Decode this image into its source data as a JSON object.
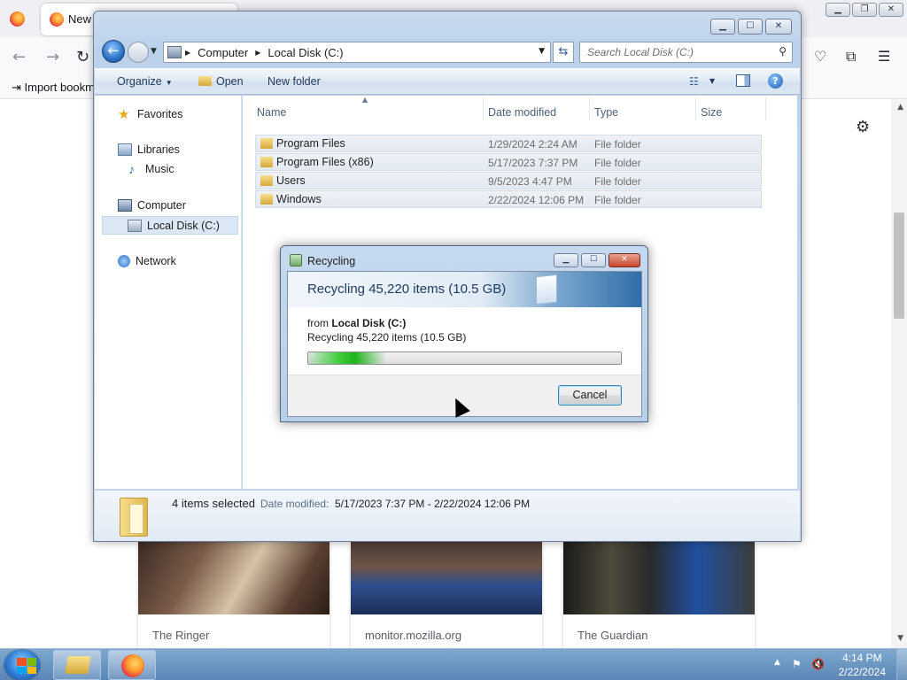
{
  "firefox": {
    "tab_title": "New",
    "bookmark_label": "Import bookm",
    "cards": [
      {
        "title": "The Ringer"
      },
      {
        "title": "monitor.mozilla.org"
      },
      {
        "title": "The Guardian"
      }
    ]
  },
  "explorer": {
    "address": [
      "Computer",
      "Local Disk (C:)"
    ],
    "search_placeholder": "Search Local Disk (C:)",
    "toolbar": {
      "organize": "Organize",
      "open": "Open",
      "new_folder": "New folder"
    },
    "nav": {
      "favorites": "Favorites",
      "libraries": "Libraries",
      "music": "Music",
      "computer": "Computer",
      "local_disk": "Local Disk (C:)",
      "network": "Network"
    },
    "columns": {
      "name": "Name",
      "date": "Date modified",
      "type": "Type",
      "size": "Size"
    },
    "files": [
      {
        "name": "Program Files",
        "date": "1/29/2024 2:24 AM",
        "type": "File folder"
      },
      {
        "name": "Program Files (x86)",
        "date": "5/17/2023 7:37 PM",
        "type": "File folder"
      },
      {
        "name": "Users",
        "date": "9/5/2023 4:47 PM",
        "type": "File folder"
      },
      {
        "name": "Windows",
        "date": "2/22/2024 12:06 PM",
        "type": "File folder"
      }
    ],
    "details": {
      "count": "4 items selected",
      "date_label": "Date modified:",
      "date_value": "5/17/2023 7:37 PM - 2/22/2024 12:06 PM"
    }
  },
  "dialog": {
    "title": "Recycling",
    "header": "Recycling 45,220 items (10.5 GB)",
    "from_prefix": "from",
    "from_location": "Local Disk (C:)",
    "status": "Recycling 45,220 items (10.5 GB)",
    "progress_fraction": 0.25,
    "cancel_label": "Cancel"
  },
  "taskbar": {
    "time": "4:14 PM",
    "date": "2/22/2024"
  },
  "colors": {
    "progress_green": "#3fcc3c",
    "taskbar_blue": "#5b86b5",
    "accent_blue": "#2b6fc4"
  }
}
